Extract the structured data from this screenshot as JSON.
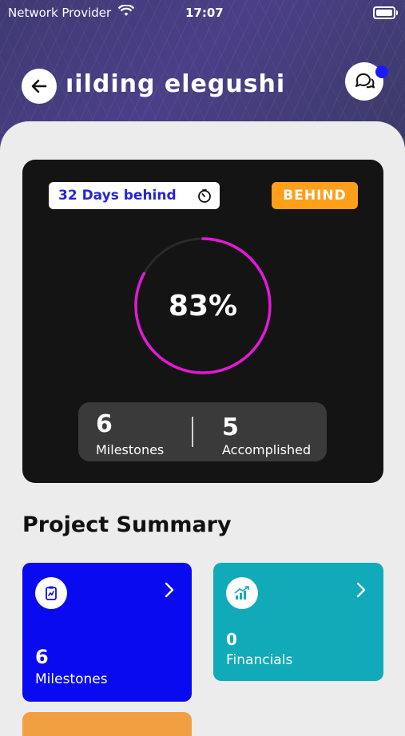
{
  "status_bar": {
    "carrier": "Network Provider",
    "time": "17:07"
  },
  "header": {
    "title": "ıilding elegushi",
    "back_icon": "arrow-left-icon",
    "chat_icon": "chat-bubbles-icon",
    "notification_dot_color": "#1a1aff"
  },
  "progress_card": {
    "behind_text": "32 Days behind",
    "timer_icon": "timer-icon",
    "status_badge": "BEHIND",
    "status_badge_color": "#ff9f1a",
    "percent_label": "83%",
    "percent_value": 83,
    "ring_color": "#e01ad6",
    "milestones_count": "6",
    "milestones_label": "Milestones",
    "accomplished_count": "5",
    "accomplished_label": "Accomplished"
  },
  "summary": {
    "title": "Project Summary",
    "cards": [
      {
        "icon": "clipboard-chart-icon",
        "count": "6",
        "label": "Milestones",
        "color": "#0a0af0"
      },
      {
        "icon": "growth-chart-icon",
        "count": "0",
        "label": "Financials",
        "color": "#10aab8"
      }
    ],
    "next_card_color": "#f0a040"
  }
}
